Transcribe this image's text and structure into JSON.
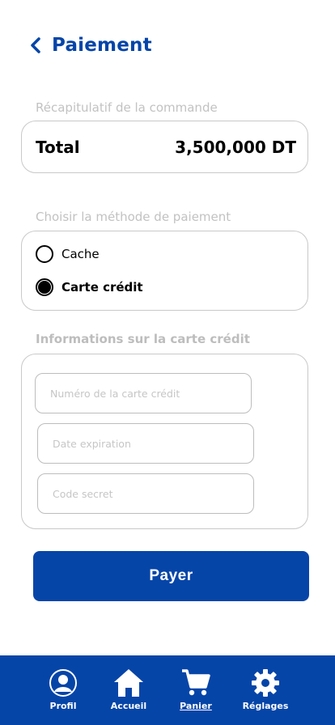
{
  "header": {
    "title": "Paiement",
    "back_icon": "chevron-left-icon"
  },
  "summary": {
    "section_label": "Récapitulatif de la commande",
    "total_label": "Total",
    "total_value": "3,500,000 DT"
  },
  "payment_method": {
    "section_label": "Choisir la méthode de paiement",
    "options": [
      {
        "label": "Cache",
        "selected": false
      },
      {
        "label": "Carte crédit",
        "selected": true
      }
    ]
  },
  "card_info": {
    "section_label": "Informations sur la carte crédit",
    "fields": [
      {
        "placeholder": "Numéro de la carte crédit",
        "value": ""
      },
      {
        "placeholder": "Date expiration",
        "value": ""
      },
      {
        "placeholder": "Code secret",
        "value": ""
      }
    ]
  },
  "pay_button": {
    "label": "Payer"
  },
  "colors": {
    "brand": "#0645a8",
    "border": "#c9c9c9",
    "muted": "#c2c2c2"
  },
  "bottom_nav": {
    "items": [
      {
        "label": "Profil",
        "icon": "user-icon",
        "active": false
      },
      {
        "label": "Accueil",
        "icon": "home-icon",
        "active": false
      },
      {
        "label": "Panier",
        "icon": "cart-icon",
        "active": true
      },
      {
        "label": "Réglages",
        "icon": "gear-icon",
        "active": false
      }
    ]
  }
}
